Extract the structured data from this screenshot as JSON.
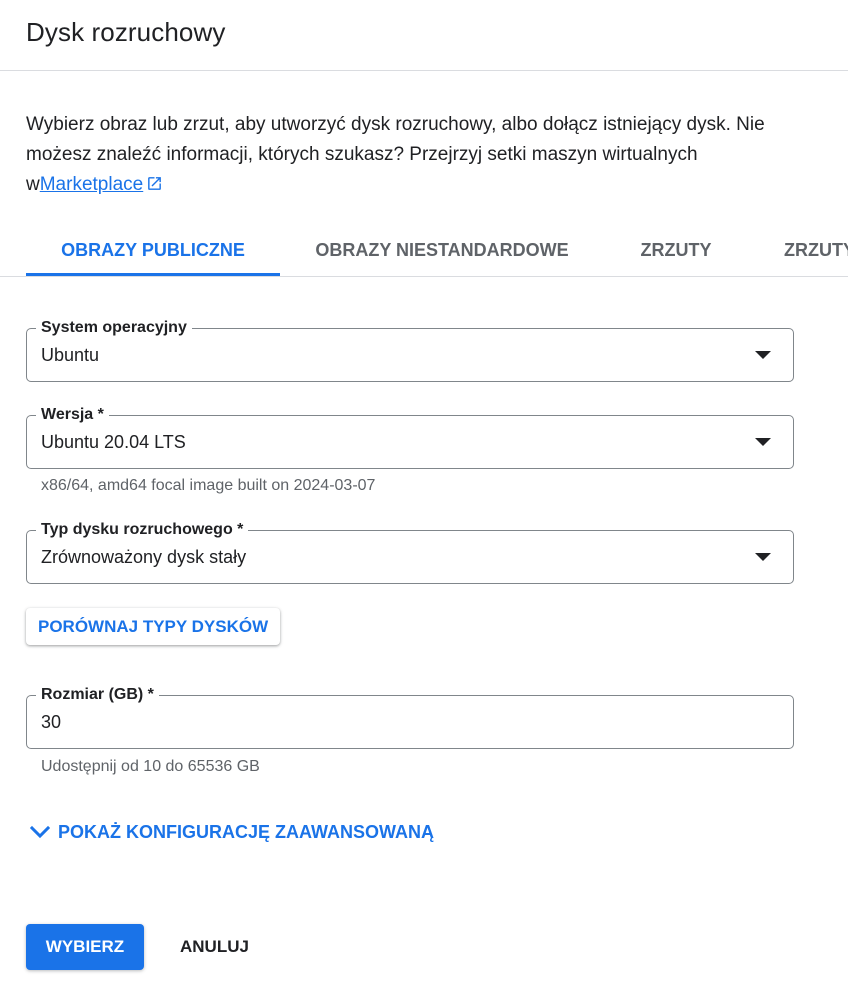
{
  "dialog": {
    "title": "Dysk rozruchowy"
  },
  "intro": {
    "text": "Wybierz obraz lub zrzut, aby utworzyć dysk rozruchowy, albo dołącz istniejący dysk. Nie możesz znaleźć informacji, których szukasz? Przejrzyj setki maszyn wirtualnych w",
    "link_label": "Marketplace",
    "link_icon": "open-in-new-icon"
  },
  "tabs": [
    {
      "label": "OBRAZY PUBLICZNE",
      "active": true
    },
    {
      "label": "OBRAZY NIESTANDARDOWE",
      "active": false
    },
    {
      "label": "ZRZUTY",
      "active": false
    },
    {
      "label": "ZRZUTY",
      "active": false
    }
  ],
  "fields": {
    "os": {
      "label": "System operacyjny",
      "value": "Ubuntu"
    },
    "version": {
      "label": "Wersja *",
      "value": "Ubuntu 20.04 LTS",
      "hint": "x86/64, amd64 focal image built on 2024-03-07"
    },
    "disk_type": {
      "label": "Typ dysku rozruchowego *",
      "value": "Zrównoważony dysk stały"
    },
    "size": {
      "label": "Rozmiar (GB) *",
      "value": "30",
      "hint": "Udostępnij od 10 do 65536 GB"
    }
  },
  "compare_button": "PORÓWNAJ TYPY DYSKÓW",
  "advanced_toggle": {
    "label": "POKAŻ KONFIGURACJĘ ZAAWANSOWANĄ",
    "icon": "chevron-down-icon"
  },
  "actions": {
    "select": "WYBIERZ",
    "cancel": "ANULUJ"
  },
  "colors": {
    "accent": "#1a73e8",
    "text": "#202124",
    "muted": "#5f6368",
    "divider": "#dadce0"
  }
}
